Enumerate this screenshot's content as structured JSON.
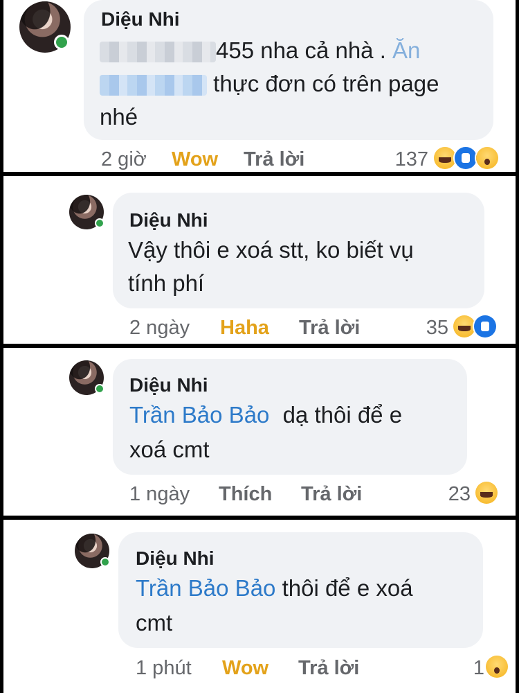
{
  "comments": [
    {
      "author": "Diệu Nhi",
      "text_line1": "455 nha cả nhà .",
      "mention_tail": "Ăn",
      "text_line2": "thực đơn có trên page",
      "text_line3": "nhé",
      "time": "2 giờ",
      "reaction_label": "Wow",
      "reply_label": "Trả lời",
      "reaction_count": "137",
      "reactions": [
        "haha-icon",
        "like-icon",
        "wow-icon"
      ]
    },
    {
      "author": "Diệu Nhi",
      "text_line1": "Vậy thôi e xoá stt, ko biết vụ",
      "text_line2": "tính phí",
      "time": "2 ngày",
      "reaction_label": "Haha",
      "reply_label": "Trả lời",
      "reaction_count": "35",
      "reactions": [
        "haha-icon",
        "like-icon"
      ]
    },
    {
      "author": "Diệu Nhi",
      "mention": "Trần Bảo Bảo",
      "text_line1": "dạ thôi để e",
      "text_line2": "xoá cmt",
      "time": "1 ngày",
      "reaction_label": "Thích",
      "reply_label": "Trả lời",
      "reaction_count": "23",
      "reactions": [
        "haha-icon"
      ]
    },
    {
      "author": "Diệu Nhi",
      "mention": "Trần Bảo Bảo",
      "text_line1": "thôi để e xoá",
      "text_line2": "cmt",
      "time": "1 phút",
      "reaction_label": "Wow",
      "reply_label": "Trả lời",
      "reaction_count": "1",
      "reactions": [
        "wow-icon"
      ]
    }
  ],
  "colors": {
    "mention": "#2d7ac9",
    "reaction_active": "#e3a21a",
    "meta": "#65676b",
    "bubble": "#f0f2f5",
    "online": "#31a24c"
  }
}
